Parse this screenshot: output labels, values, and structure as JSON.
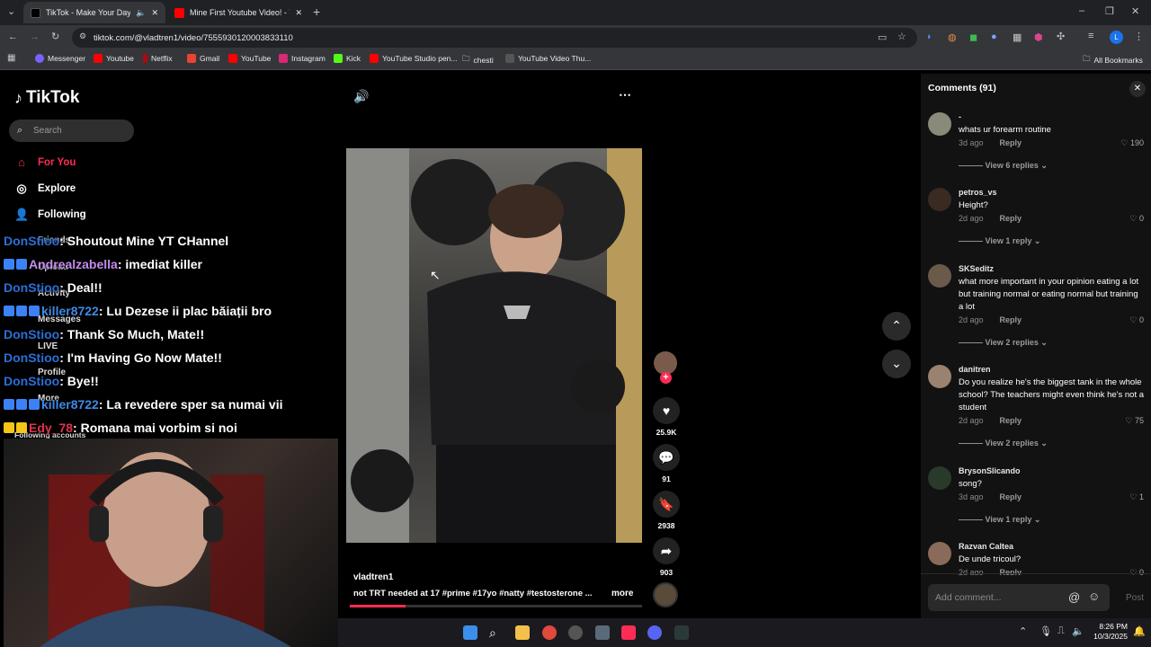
{
  "browser": {
    "tabs": [
      {
        "title": "TikTok - Make Your Day",
        "active": true
      },
      {
        "title": "Mine First Youtube Video! - You",
        "active": false
      }
    ],
    "url": "tiktok.com/@vladtren1/video/7555930120003833110",
    "bookmarks": [
      "Messenger",
      "Youtube",
      "Netflix",
      "Gmail",
      "YouTube",
      "Instagram",
      "Kick",
      "YouTube Studio pen...",
      "chesti",
      "YouTube Video Thu...",
      "All Bookmarks"
    ]
  },
  "tiktok": {
    "logo": "TikTok",
    "search_placeholder": "Search",
    "nav": [
      {
        "label": "For You",
        "icon": "home-icon"
      },
      {
        "label": "Explore",
        "icon": "compass-icon"
      },
      {
        "label": "Following",
        "icon": "person-icon"
      }
    ],
    "nav_hidden": [
      "Friends",
      "Upload",
      "Activity",
      "Messages",
      "LIVE",
      "Profile",
      "More",
      "Following accounts"
    ]
  },
  "chat": [
    {
      "user": "DonStioo",
      "message": ": Shoutout Mine YT CHannel",
      "color": "#2b6fd6"
    },
    {
      "user": "Andrealzabella",
      "message": ": imediat killer",
      "color": "#c58cf0"
    },
    {
      "user": "DonStioo",
      "message": ": Deal!!",
      "color": "#2b6fd6"
    },
    {
      "user": "killer8722",
      "message": ": Lu Dezese ii plac băiații bro",
      "color": "#3e8be6"
    },
    {
      "user": "DonStioo",
      "message": ": Thank So Much, Mate!!",
      "color": "#2b6fd6"
    },
    {
      "user": "DonStioo",
      "message": ": I'm Having Go Now Mate!!",
      "color": "#2b6fd6"
    },
    {
      "user": "DonStioo",
      "message": ": Bye!!",
      "color": "#2b6fd6"
    },
    {
      "user": "killer8722",
      "message": ": La revedere sper sa numai vii",
      "color": "#3e8be6"
    },
    {
      "user": "Edy_78",
      "message": ": Romana mai vorbim si noi",
      "color": "#e0344a"
    }
  ],
  "video": {
    "author": "vladtren1",
    "caption": "not TRT needed at 17 #prime  #17yo  #natty  #testosterone ...",
    "more": "more",
    "likes": "25.9K",
    "comments": "91",
    "saves": "2938",
    "shares": "903",
    "progress": 0.19
  },
  "comments_panel": {
    "title": "Comments (91)",
    "items": [
      {
        "user": "-",
        "text": "whats ur forearm routine",
        "age": "3d ago",
        "reply": "Reply",
        "likes": "190",
        "view": "View 6 replies"
      },
      {
        "user": "petros_vs",
        "text": "Height?",
        "age": "2d ago",
        "reply": "Reply",
        "likes": "0",
        "view": "View 1 reply"
      },
      {
        "user": "SKSeditz",
        "text": "what more important in your opinion eating a lot but training normal or eating normal but training a lot",
        "age": "2d ago",
        "reply": "Reply",
        "likes": "0",
        "view": "View 2 replies"
      },
      {
        "user": "danitren",
        "text": "Do you realize he's the biggest tank in the whole school? The teachers might even think he's not a student",
        "age": "2d ago",
        "reply": "Reply",
        "likes": "75",
        "view": "View 2 replies"
      },
      {
        "user": "BrysonSlicando",
        "text": "song?",
        "age": "3d ago",
        "reply": "Reply",
        "likes": "1",
        "view": "View 1 reply"
      },
      {
        "user": "Razvan Caltea",
        "text": "De unde tricoul?",
        "age": "2d ago",
        "reply": "Reply",
        "likes": "0",
        "view": ""
      }
    ],
    "add_placeholder": "Add comment...",
    "post": "Post"
  },
  "taskbar": {
    "time": "8:26 PM",
    "date": "10/3/2025"
  }
}
